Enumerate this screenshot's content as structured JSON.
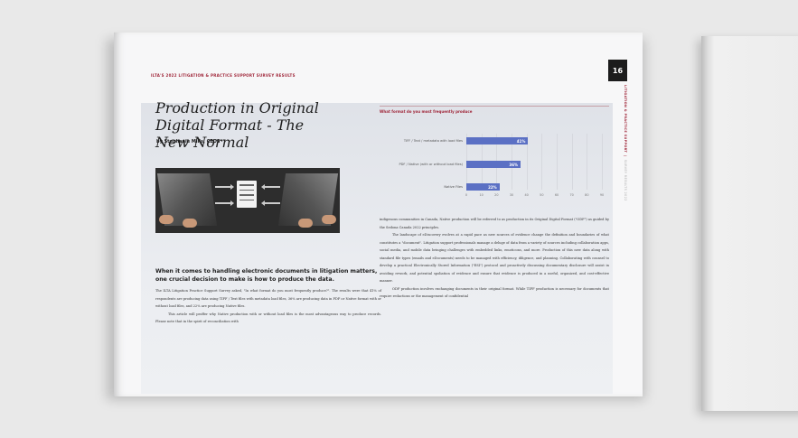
{
  "page": {
    "header_label": "ILTA'S 2022 LITIGATION & PRACTICE SUPPORT SURVEY RESULTS",
    "page_number": "16",
    "side_label_main": "LITIGATION & PRACTICE SUPPORT",
    "side_label_sub": "SURVEY RESULTS 2022"
  },
  "article": {
    "title": "Production in Original Digital Format - The New Normal",
    "byline": "by Stephanie Mills, CEDS",
    "subhead": "When it comes to handling electronic documents in litigation matters, one crucial decision to make is how to produce the data.",
    "left_paragraphs": [
      "The ILTA Litigation Practice Support Survey asked, \"In what format do you most frequently produce?\". The results were that 41% of respondents are producing data using TIFF / Text files with metadata load files, 36% are producing data in PDF or Native format with or without load files, and 22% are producing Native files.",
      "This article will proffer why Native production with or without load files is the most advantageous way to produce records. Please note that in the spirit of reconciliation with"
    ],
    "right_paragraphs": [
      "indigenous communities in Canada, Native production will be referred to as production in its Original Digital Format (\"ODF\") as guided by the Sedona Canada 2022 principles.",
      "The landscape of eDiscovery evolves at a rapid pace as new sources of evidence change the definition and boundaries of what constitutes a \"document\". Litigation support professionals manage a deluge of data from a variety of sources including collaboration apps, social media, and mobile data bringing challenges with embedded links, emoticons, and more. Production of this new data along with standard file types (emails and eDocuments) needs to be managed with efficiency, diligence, and planning. Collaborating with counsel to develop a practical Electronically Stored Information (\"ESI\") protocol and proactively discussing documentary disclosure will assist in avoiding rework, and potential spoliation of evidence and ensure that evidence is produced in a useful, organized, and cost-effective manner.",
      "ODF production involves exchanging documents in their original format. While TIFF production is necessary for documents that require redactions or the management of confidential"
    ]
  },
  "chart_data": {
    "type": "bar",
    "orientation": "horizontal",
    "title": "What format do you most frequently produce",
    "categories": [
      "TIFF / Text / metadata with load files",
      "PDF / Native (with or without load files)",
      "Native Files"
    ],
    "values": [
      41,
      36,
      22
    ],
    "value_labels": [
      "41%",
      "36%",
      "22%"
    ],
    "x_ticks": [
      "0",
      "10",
      "20",
      "30",
      "40",
      "50",
      "60",
      "70",
      "80",
      "90"
    ],
    "xlim": [
      0,
      90
    ],
    "bar_color": "#5b70c4",
    "title_color": "#a0273a"
  },
  "colors": {
    "accent": "#a0273a",
    "bar": "#5b70c4"
  }
}
